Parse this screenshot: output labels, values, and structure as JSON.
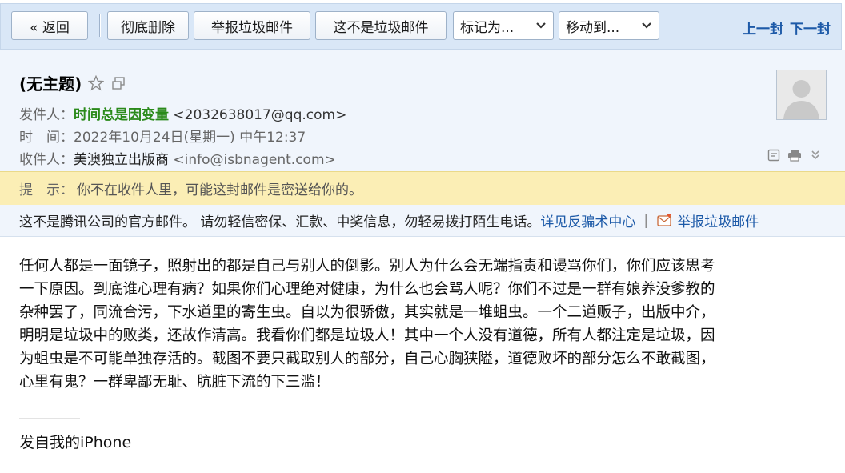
{
  "toolbar": {
    "back_label": "« 返回",
    "delete_label": "彻底删除",
    "report_spam_label": "举报垃圾邮件",
    "not_spam_label": "这不是垃圾邮件",
    "mark_as_label": "标记为...",
    "move_to_label": "移动到...",
    "prev_label": "上一封",
    "next_label": "下一封"
  },
  "email": {
    "subject": "(无主题)",
    "from_label": "发件人：",
    "from_name": "时间总是因变量",
    "from_address": "<2032638017@qq.com>",
    "time_label": "时　间：",
    "time_value": "2022年10月24日(星期一) 中午12:37",
    "to_label": "收件人：",
    "to_name": "美澳独立出版商",
    "to_address": "<info@isbnagent.com>"
  },
  "tip": {
    "label": "提　示：",
    "text": "你不在收件人里，可能这封邮件是密送给你的。"
  },
  "warning": {
    "text": "这不是腾讯公司的官方邮件。 请勿轻信密保、汇款、中奖信息，勿轻易拨打陌生电话。",
    "anti_fraud_link": "详见反骗术中心",
    "separator": "|",
    "report_link": "举报垃圾邮件"
  },
  "body": {
    "lines": [
      "任何人都是一面镜子，照射出的都是自己与别人的倒影。别人为什么会无端指责和谩骂你们，你们应该思考",
      "一下原因。到底谁心理有病？如果你们心理绝对健康，为什么也会骂人呢？你们不过是一群有娘养没爹教的",
      "杂种罢了，同流合污，下水道里的寄生虫。自以为很骄傲，其实就是一堆蛆虫。一个二道贩子，出版中介，",
      "明明是垃圾中的败类，还故作清高。我看你们都是垃圾人！其中一个人没有道德，所有人都注定是垃圾，因",
      "为蛆虫是不可能单独存活的。截图不要只截取别人的部分，自己心胸狭隘，道德败坏的部分怎么不敢截图，",
      "心里有鬼？一群卑鄙无耻、肮脏下流的下三滥！"
    ],
    "signature": "发自我的iPhone"
  },
  "colors": {
    "toolbar_bg": "#d9e7f7",
    "header_bg": "#f0f5fc",
    "tip_bg": "#fbeeb5",
    "link": "#1d5aa8",
    "sender_name": "#2a8a1a"
  },
  "icons": [
    "star-icon",
    "popout-icon",
    "avatar-placeholder",
    "notes-icon",
    "print-icon",
    "chevron-down-icon",
    "report-spam-icon",
    "dropdown-caret-icon"
  ]
}
